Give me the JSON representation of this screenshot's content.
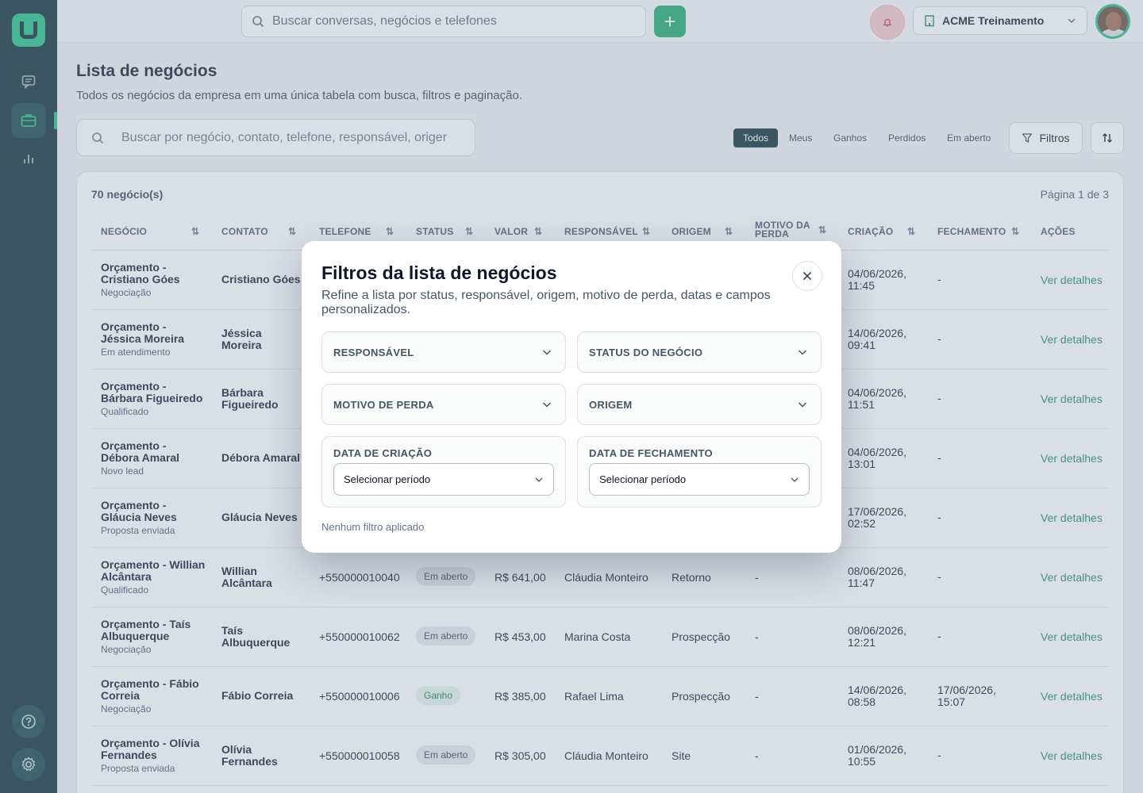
{
  "topbar": {
    "search_placeholder": "Buscar conversas, negócios e telefones",
    "add_label": "+",
    "company_name": "ACME Treinamento"
  },
  "page": {
    "title": "Lista de negócios",
    "subtitle": "Todos os negócios da empresa em uma única tabela com busca, filtros e paginação.",
    "search_placeholder": "Buscar por negócio, contato, telefone, responsável, origem",
    "segments": [
      "Todos",
      "Meus",
      "Ganhos",
      "Perdidos",
      "Em aberto"
    ],
    "active_segment": "Todos",
    "filters_label": "Filtros"
  },
  "table": {
    "count": "70 negócio(s)",
    "page_info": "Página 1 de 3",
    "headers": {
      "negocio": "NEGÓCIO",
      "contato": "CONTATO",
      "telefone": "TELEFONE",
      "status": "STATUS",
      "valor": "VALOR",
      "responsavel": "RESPONSÁVEL",
      "origem": "ORIGEM",
      "motivo_l1": "MOTIVO DA",
      "motivo_l2": "PERDA",
      "criacao": "CRIAÇÃO",
      "fechamento": "FECHAMENTO",
      "acoes": "AÇÕES"
    },
    "rows": [
      {
        "t1": "Orçamento -",
        "t2": "Cristiano Góes",
        "stage": "Negociação",
        "c1": "Cristiano Góes",
        "c2": "",
        "phone": "",
        "status": "",
        "value": "",
        "owner": "",
        "origin": "",
        "reason": "",
        "cr1": "04/06/2026,",
        "cr2": "11:45",
        "cl1": "-",
        "cl2": "",
        "action": "Ver detalhes"
      },
      {
        "t1": "Orçamento -",
        "t2": "Jéssica Moreira",
        "stage": "Em atendimento",
        "c1": "Jéssica",
        "c2": "Moreira",
        "phone": "",
        "status": "",
        "value": "",
        "owner": "",
        "origin": "",
        "reason": "",
        "cr1": "14/06/2026,",
        "cr2": "09:41",
        "cl1": "-",
        "cl2": "",
        "action": "Ver detalhes"
      },
      {
        "t1": "Orçamento -",
        "t2": "Bárbara Figueiredo",
        "stage": "Qualificado",
        "c1": "Bárbara",
        "c2": "Figueiredo",
        "phone": "",
        "status": "",
        "value": "",
        "owner": "",
        "origin": "",
        "reason": "",
        "cr1": "04/06/2026,",
        "cr2": "11:51",
        "cl1": "-",
        "cl2": "",
        "action": "Ver detalhes"
      },
      {
        "t1": "Orçamento -",
        "t2": "Débora Amaral",
        "stage": "Novo lead",
        "c1": "Débora Amaral",
        "c2": "",
        "phone": "",
        "status": "",
        "value": "",
        "owner": "",
        "origin": "",
        "reason": "",
        "cr1": "04/06/2026,",
        "cr2": "13:01",
        "cl1": "-",
        "cl2": "",
        "action": "Ver detalhes"
      },
      {
        "t1": "Orçamento -",
        "t2": "Gláucia Neves",
        "stage": "Proposta enviada",
        "c1": "Gláucia Neves",
        "c2": "",
        "phone": "",
        "status": "",
        "value": "",
        "owner": "",
        "origin": "",
        "reason": "",
        "cr1": "17/06/2026,",
        "cr2": "02:52",
        "cl1": "-",
        "cl2": "",
        "action": "Ver detalhes"
      },
      {
        "t1": "Orçamento - Willian",
        "t2": "Alcântara",
        "stage": "Qualificado",
        "c1": "Willian",
        "c2": "Alcântara",
        "phone": "+550000010040",
        "status": "Em aberto",
        "value": "R$ 641,00",
        "owner": "Cláudia Monteiro",
        "origin": "Retorno",
        "reason": "-",
        "cr1": "08/06/2026,",
        "cr2": "11:47",
        "cl1": "-",
        "cl2": "",
        "action": "Ver detalhes"
      },
      {
        "t1": "Orçamento - Taís",
        "t2": "Albuquerque",
        "stage": "Negociação",
        "c1": "Taís",
        "c2": "Albuquerque",
        "phone": "+550000010062",
        "status": "Em aberto",
        "value": "R$ 453,00",
        "owner": "Marina Costa",
        "origin": "Prospecção",
        "reason": "-",
        "cr1": "08/06/2026,",
        "cr2": "12:21",
        "cl1": "-",
        "cl2": "",
        "action": "Ver detalhes"
      },
      {
        "t1": "Orçamento - Fábio",
        "t2": "Correia",
        "stage": "Negociação",
        "c1": "Fábio Correia",
        "c2": "",
        "phone": "+550000010006",
        "status": "Ganho",
        "value": "R$ 385,00",
        "owner": "Rafael Lima",
        "origin": "Prospecção",
        "reason": "-",
        "cr1": "14/06/2026,",
        "cr2": "08:58",
        "cl1": "17/06/2026,",
        "cl2": "15:07",
        "action": "Ver detalhes"
      },
      {
        "t1": "Orçamento - Olívia",
        "t2": "Fernandes",
        "stage": "Proposta enviada",
        "c1": "Olívia",
        "c2": "Fernandes",
        "phone": "+550000010058",
        "status": "Em aberto",
        "value": "R$ 305,00",
        "owner": "Cláudia Monteiro",
        "origin": "Site",
        "reason": "-",
        "cr1": "01/06/2026,",
        "cr2": "10:55",
        "cl1": "-",
        "cl2": "",
        "action": "Ver detalhes"
      }
    ]
  },
  "modal": {
    "title": "Filtros da lista de negócios",
    "subtitle": "Refine a lista por status, responsável, origem, motivo de perda, datas e campos personalizados.",
    "responsavel": "RESPONSÁVEL",
    "status": "STATUS DO NEGÓCIO",
    "motivo": "MOTIVO DE PERDA",
    "origem": "ORIGEM",
    "data_criacao": "DATA DE CRIAÇÃO",
    "data_fechamento": "DATA DE FECHAMENTO",
    "period_placeholder": "Selecionar período",
    "no_filter": "Nenhum filtro aplicado"
  },
  "colors": {
    "sidebar": "#0b2d35",
    "accent": "#1aa86a",
    "link": "#1a8a57"
  }
}
